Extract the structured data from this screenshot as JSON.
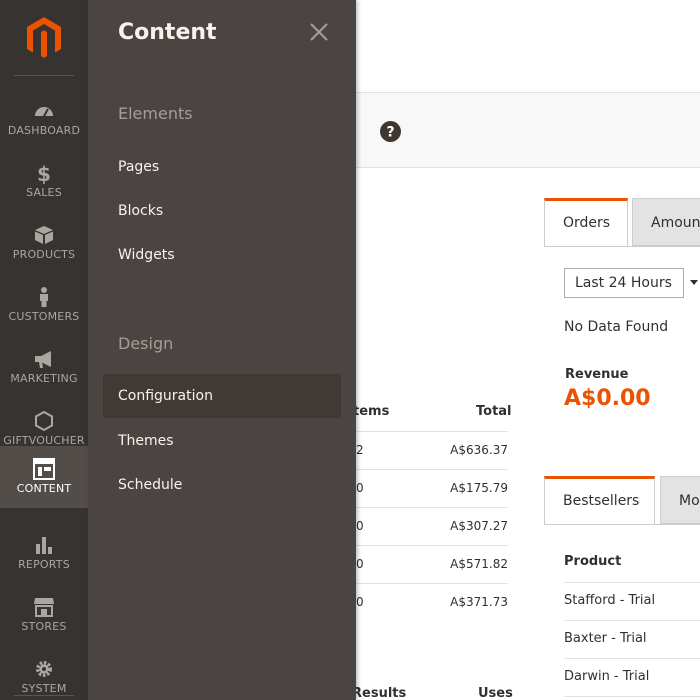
{
  "sidebar": {
    "logo": "magento-logo",
    "items": [
      {
        "label": "DASHBOARD",
        "icon": "gauge-icon",
        "active": false
      },
      {
        "label": "SALES",
        "icon": "dollar-icon",
        "active": false
      },
      {
        "label": "PRODUCTS",
        "icon": "box-icon",
        "active": false
      },
      {
        "label": "CUSTOMERS",
        "icon": "person-icon",
        "active": false
      },
      {
        "label": "MARKETING",
        "icon": "megaphone-icon",
        "active": false
      },
      {
        "label": "GIFTVOUCHER",
        "icon": "hexagon-icon",
        "active": false
      },
      {
        "label": "CONTENT",
        "icon": "layout-icon",
        "active": true
      },
      {
        "label": "REPORTS",
        "icon": "bar-chart-icon",
        "active": false
      },
      {
        "label": "STORES",
        "icon": "storefront-icon",
        "active": false
      },
      {
        "label": "SYSTEM",
        "icon": "gear-icon",
        "active": false
      }
    ]
  },
  "flyout": {
    "title": "Content",
    "sections": [
      {
        "title": "Elements",
        "links": [
          "Pages",
          "Blocks",
          "Widgets"
        ]
      },
      {
        "title": "Design",
        "links": [
          "Configuration",
          "Themes",
          "Schedule"
        ]
      }
    ],
    "active_link": "Configuration"
  },
  "main": {
    "tabs": {
      "orders": "Orders",
      "amounts": "Amoun"
    },
    "period_select": "Last 24 Hours",
    "no_data": "No Data Found",
    "revenue_label": "Revenue",
    "revenue_value": "A$0.00",
    "orders_table": {
      "headers": {
        "items": "tems",
        "total": "Total"
      },
      "rows": [
        {
          "items": "2",
          "total": "A$636.37"
        },
        {
          "items": "0",
          "total": "A$175.79"
        },
        {
          "items": "0",
          "total": "A$307.27"
        },
        {
          "items": "0",
          "total": "A$571.82"
        },
        {
          "items": "0",
          "total": "A$371.73"
        }
      ]
    },
    "search_table": {
      "headers": {
        "results": "Results",
        "uses": "Uses"
      }
    },
    "bestsellers": {
      "tabs": {
        "bestsellers": "Bestsellers",
        "more": "Mo"
      },
      "header": "Product",
      "rows": [
        "Stafford - Trial",
        "Baxter - Trial",
        "Darwin - Trial"
      ]
    }
  },
  "colors": {
    "accent": "#eb5202",
    "sidebar": "#373330",
    "flyout": "#4a4542"
  }
}
